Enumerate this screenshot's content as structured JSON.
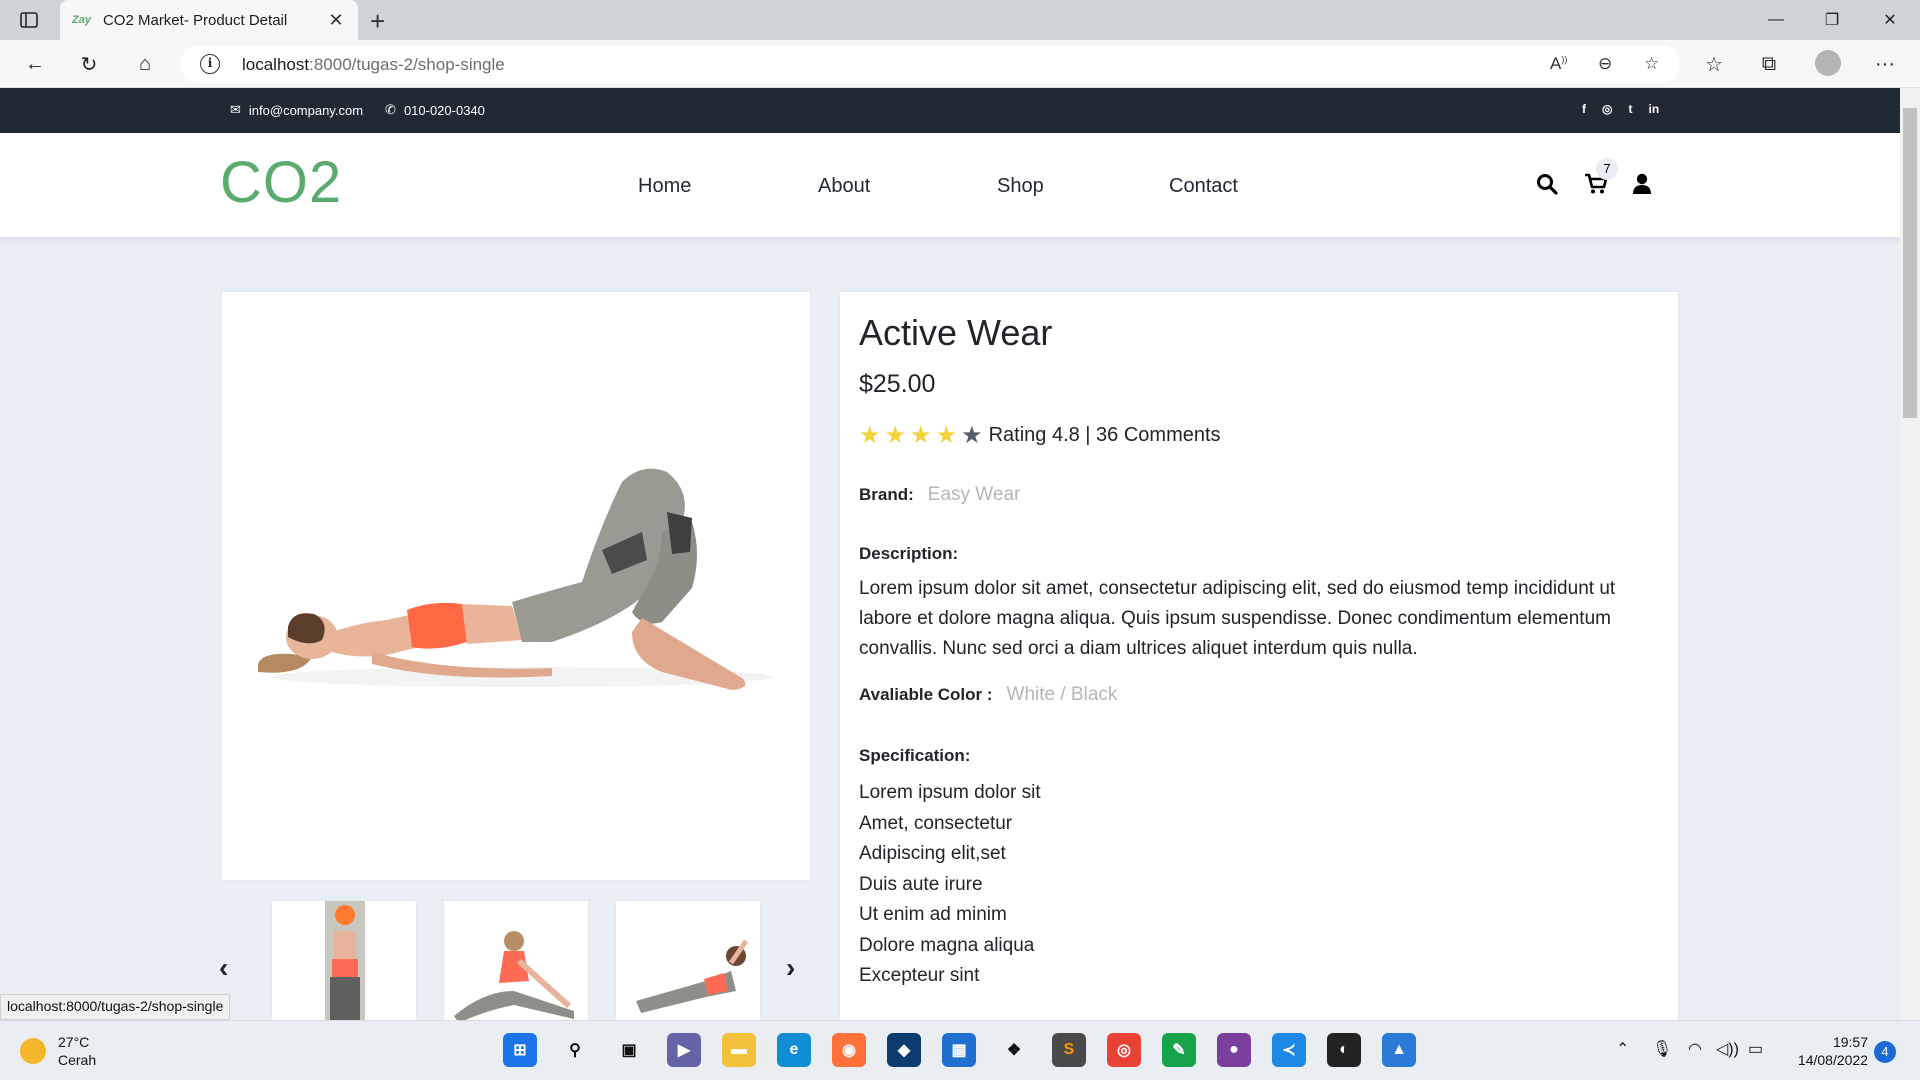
{
  "browser": {
    "tab_title": "CO2 Market- Product Detail",
    "tab_favicon_text": "Zay",
    "url_host": "localhost",
    "url_rest": ":8000/tugas-2/shop-single"
  },
  "topbar": {
    "email": "info@company.com",
    "phone": "010-020-0340",
    "social": [
      "f",
      "◎",
      "t",
      "in"
    ]
  },
  "header": {
    "logo": "CO2",
    "menu": [
      "Home",
      "About",
      "Shop",
      "Contact"
    ],
    "cart_count": "7"
  },
  "product": {
    "title": "Active Wear",
    "price": "$25.00",
    "rating_text": "Rating 4.8 | 36 Comments",
    "rating_stars": 4,
    "brand_label": "Brand:",
    "brand": "Easy Wear",
    "description_label": "Description:",
    "description": "Lorem ipsum dolor sit amet, consectetur adipiscing elit, sed do eiusmod temp incididunt ut labore et dolore magna aliqua. Quis ipsum suspendisse. Donec condimentum elementum convallis. Nunc sed orci a diam ultrices aliquet interdum quis nulla.",
    "color_label": "Avaliable Color :",
    "colors": "White / Black",
    "spec_label": "Specification:",
    "specs": [
      "Lorem ipsum dolor sit",
      "Amet, consectetur",
      "Adipiscing elit,set",
      "Duis aute irure",
      "Ut enim ad minim",
      "Dolore magna aliqua",
      "Excepteur sint"
    ]
  },
  "status_url": "localhost:8000/tugas-2/shop-single",
  "taskbar": {
    "weather_temp": "27°C",
    "weather_desc": "Cerah",
    "time": "19:57",
    "date": "14/08/2022",
    "notifications": "4"
  },
  "colors": {
    "accent": "#59ab6e",
    "dark": "#212934",
    "star": "#f4d23c",
    "star_empty": "#555e6b"
  }
}
